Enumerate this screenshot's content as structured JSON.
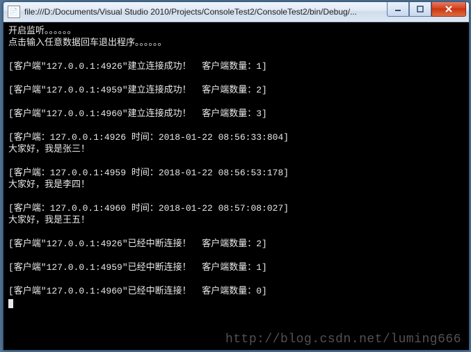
{
  "window": {
    "icon_glyph": "📄",
    "title": "file:///D:/Documents/Visual Studio 2010/Projects/ConsoleTest2/ConsoleTest2/bin/Debug/..."
  },
  "console": {
    "lines": [
      "开启监听。。。。。。",
      "点击输入任意数据回车退出程序。。。。。。",
      "",
      "[客户端\"127.0.0.1:4926\"建立连接成功！  客户端数量：1]",
      "",
      "[客户端\"127.0.0.1:4959\"建立连接成功！  客户端数量：2]",
      "",
      "[客户端\"127.0.0.1:4960\"建立连接成功！  客户端数量：3]",
      "",
      "[客户端：127.0.0.1:4926 时间：2018-01-22 08:56:33:804]",
      "大家好，我是张三！",
      "",
      "[客户端：127.0.0.1:4959 时间：2018-01-22 08:56:53:178]",
      "大家好，我是李四！",
      "",
      "[客户端：127.0.0.1:4960 时间：2018-01-22 08:57:08:027]",
      "大家好，我是王五！",
      "",
      "[客户端\"127.0.0.1:4926\"已经中断连接！  客户端数量：2]",
      "",
      "[客户端\"127.0.0.1:4959\"已经中断连接！  客户端数量：1]",
      "",
      "[客户端\"127.0.0.1:4960\"已经中断连接！  客户端数量：0]"
    ]
  },
  "watermark": "http://blog.csdn.net/luming666"
}
